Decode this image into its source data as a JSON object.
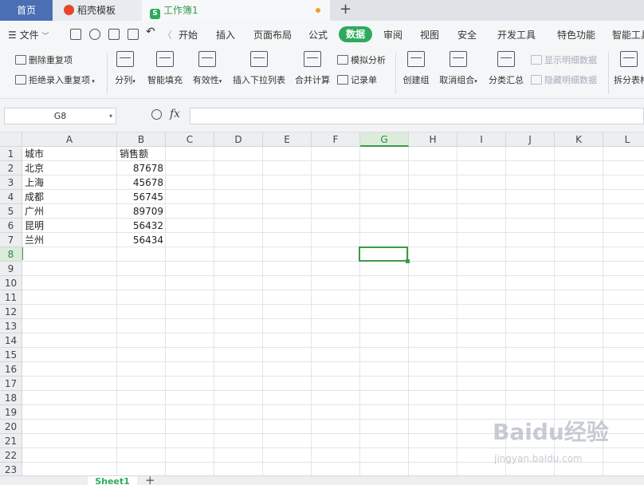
{
  "tabs": {
    "home": "首页",
    "template": "稻壳模板",
    "workbook": "工作簿1",
    "new_tab": "+"
  },
  "menu": {
    "file": "文件",
    "items": [
      "开始",
      "插入",
      "页面布局",
      "公式",
      "数据",
      "审阅",
      "视图",
      "安全",
      "开发工具",
      "特色功能",
      "智能工具"
    ],
    "active": "数据"
  },
  "ribbon": {
    "remove_duplicates": "删除重复项",
    "reject_duplicates": "拒绝录入重复项",
    "split_columns": "分列",
    "smart_fill": "智能填充",
    "validity": "有效性",
    "insert_dropdown": "插入下拉列表",
    "merge_calc": "合并计算",
    "simulate": "模拟分析",
    "record_form": "记录单",
    "create_group": "创建组",
    "ungroup": "取消组合",
    "subtotal": "分类汇总",
    "show_detail": "显示明细数据",
    "hide_detail": "隐藏明细数据",
    "split_table": "拆分表格"
  },
  "formula_bar": {
    "name_box": "G8",
    "fx": "fx",
    "value": ""
  },
  "grid": {
    "columns": [
      "A",
      "B",
      "C",
      "D",
      "E",
      "F",
      "G",
      "H",
      "I",
      "J",
      "K",
      "L"
    ],
    "selected_column": "G",
    "rows": [
      "1",
      "2",
      "3",
      "4",
      "5",
      "6",
      "7",
      "8",
      "9",
      "10",
      "11",
      "12",
      "13",
      "14",
      "15",
      "16",
      "17",
      "18",
      "19",
      "20",
      "21",
      "22",
      "23"
    ],
    "selected_row": "8",
    "data": [
      {
        "a": "城市",
        "b": "销售额"
      },
      {
        "a": "北京",
        "b": "87678"
      },
      {
        "a": "上海",
        "b": "45678"
      },
      {
        "a": "成都",
        "b": "56745"
      },
      {
        "a": "广州",
        "b": "89709"
      },
      {
        "a": "昆明",
        "b": "56432"
      },
      {
        "a": "兰州",
        "b": "56434"
      }
    ]
  },
  "sheets": {
    "active": "Sheet1",
    "add": "+"
  },
  "watermark": {
    "main": "Baidu经验",
    "sub": "jingyan.baidu.com"
  }
}
